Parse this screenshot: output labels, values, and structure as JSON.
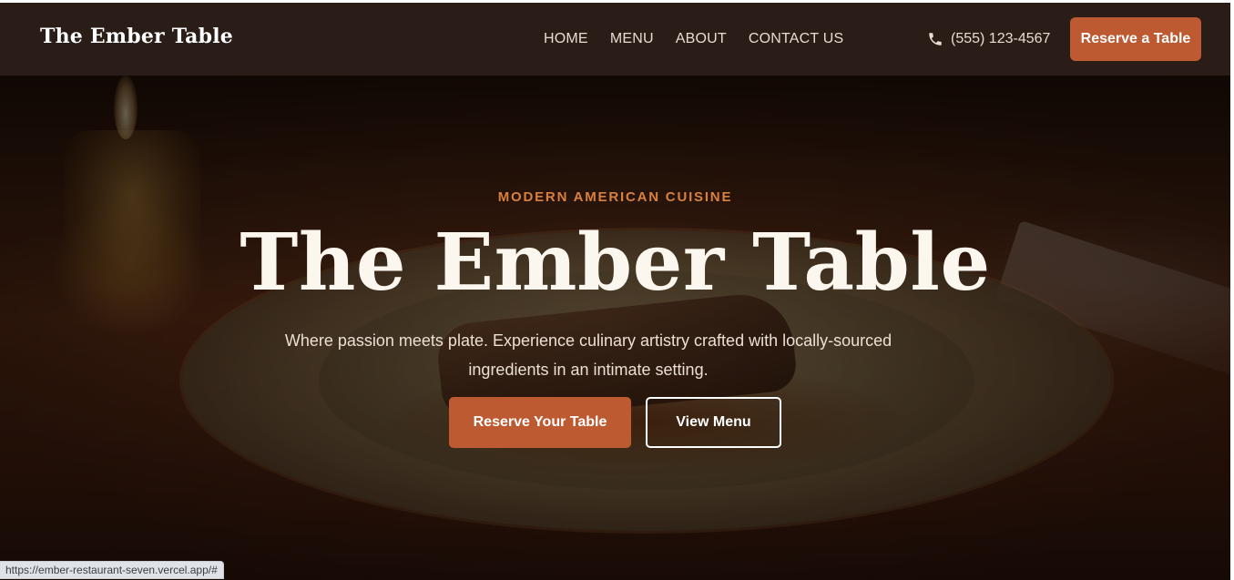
{
  "header": {
    "brand": "The Ember Table",
    "nav": [
      "HOME",
      "MENU",
      "ABOUT",
      "CONTACT US"
    ],
    "phone": "(555) 123-4567",
    "phone_icon": "phone-icon",
    "reserve_label": "Reserve a Table"
  },
  "hero": {
    "eyebrow": "MODERN AMERICAN CUISINE",
    "title": "The Ember Table",
    "subtitle": "Where passion meets plate. Experience culinary artistry crafted with locally-sourced ingredients in an intimate setting.",
    "primary_cta": "Reserve Your Table",
    "secondary_cta": "View Menu"
  },
  "status_bar": {
    "url": "https://ember-restaurant-seven.vercel.app/#"
  },
  "colors": {
    "header_bg": "#2a1d17",
    "accent": "#bd5a32",
    "eyebrow": "#d8803f",
    "title": "#fbf6ee"
  }
}
